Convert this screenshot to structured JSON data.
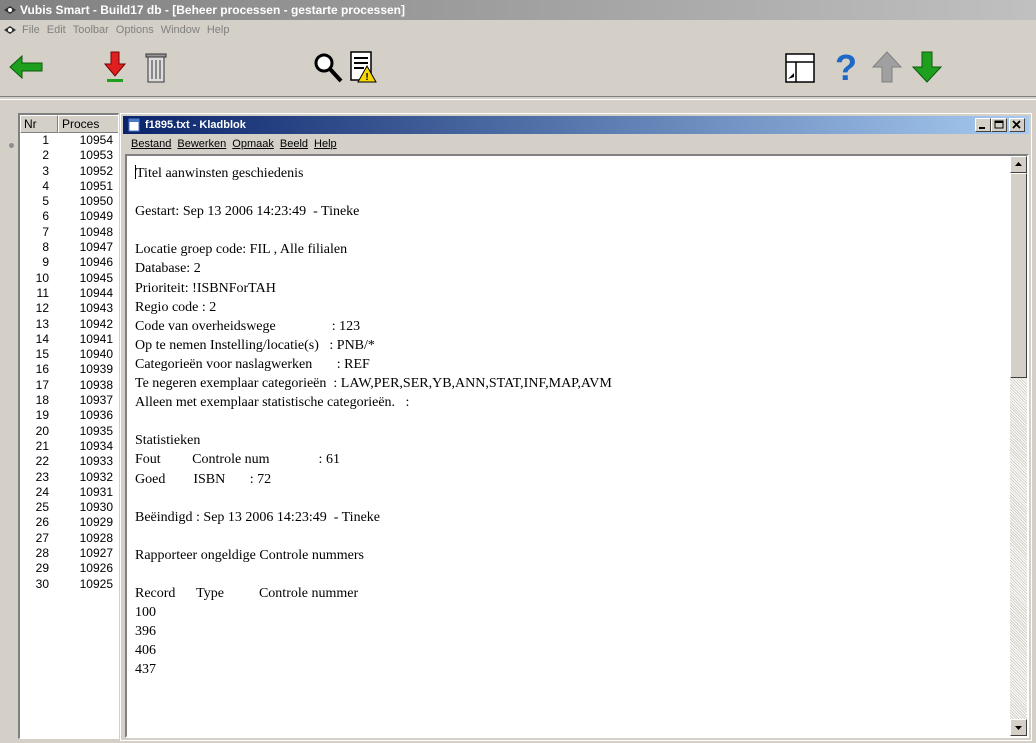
{
  "app": {
    "title": "Vubis Smart - Build17 db - [Beheer processen - gestarte processen]",
    "menu": [
      "File",
      "Edit",
      "Toolbar",
      "Options",
      "Window",
      "Help"
    ],
    "toolbar": [
      "back-arrow-icon",
      "download-arrow-icon",
      "trash-icon",
      "search-icon",
      "report-icon",
      "window-icon",
      "help-icon",
      "up-arrow-icon",
      "down-arrow-icon"
    ]
  },
  "process_list": {
    "headers": [
      "Nr",
      "Proces"
    ],
    "rows": [
      [
        "1",
        "10954"
      ],
      [
        "2",
        "10953"
      ],
      [
        "3",
        "10952"
      ],
      [
        "4",
        "10951"
      ],
      [
        "5",
        "10950"
      ],
      [
        "6",
        "10949"
      ],
      [
        "7",
        "10948"
      ],
      [
        "8",
        "10947"
      ],
      [
        "9",
        "10946"
      ],
      [
        "10",
        "10945"
      ],
      [
        "11",
        "10944"
      ],
      [
        "12",
        "10943"
      ],
      [
        "13",
        "10942"
      ],
      [
        "14",
        "10941"
      ],
      [
        "15",
        "10940"
      ],
      [
        "16",
        "10939"
      ],
      [
        "17",
        "10938"
      ],
      [
        "18",
        "10937"
      ],
      [
        "19",
        "10936"
      ],
      [
        "20",
        "10935"
      ],
      [
        "21",
        "10934"
      ],
      [
        "22",
        "10933"
      ],
      [
        "23",
        "10932"
      ],
      [
        "24",
        "10931"
      ],
      [
        "25",
        "10930"
      ],
      [
        "26",
        "10929"
      ],
      [
        "27",
        "10928"
      ],
      [
        "28",
        "10927"
      ],
      [
        "29",
        "10926"
      ],
      [
        "30",
        "10925"
      ]
    ]
  },
  "notepad": {
    "title": "f1895.txt - Kladblok",
    "menu": [
      "Bestand",
      "Bewerken",
      "Opmaak",
      "Beeld",
      "Help"
    ],
    "lines": [
      "Titel aanwinsten geschiedenis",
      "",
      "Gestart: Sep 13 2006 14:23:49  - Tineke",
      "",
      "Locatie groep code: FIL , Alle filialen",
      "Database: 2",
      "Prioriteit: !ISBNForTAH",
      "Regio code : 2",
      "Code van overheidswege                : 123",
      "Op te nemen Instelling/locatie(s)   : PNB/*",
      "Categorieën voor naslagwerken       : REF",
      "Te negeren exemplaar categorieën  : LAW,PER,SER,YB,ANN,STAT,INF,MAP,AVM",
      "Alleen met exemplaar statistische categorieën.   :",
      "",
      "Statistieken",
      "Fout         Controle num              : 61",
      "Goed        ISBN       : 72",
      "",
      "Beëindigd : Sep 13 2006 14:23:49  - Tineke",
      "",
      "Rapporteer ongeldige Controle nummers",
      "",
      "Record      Type          Controle nummer",
      "100",
      "396",
      "406",
      "437"
    ]
  }
}
